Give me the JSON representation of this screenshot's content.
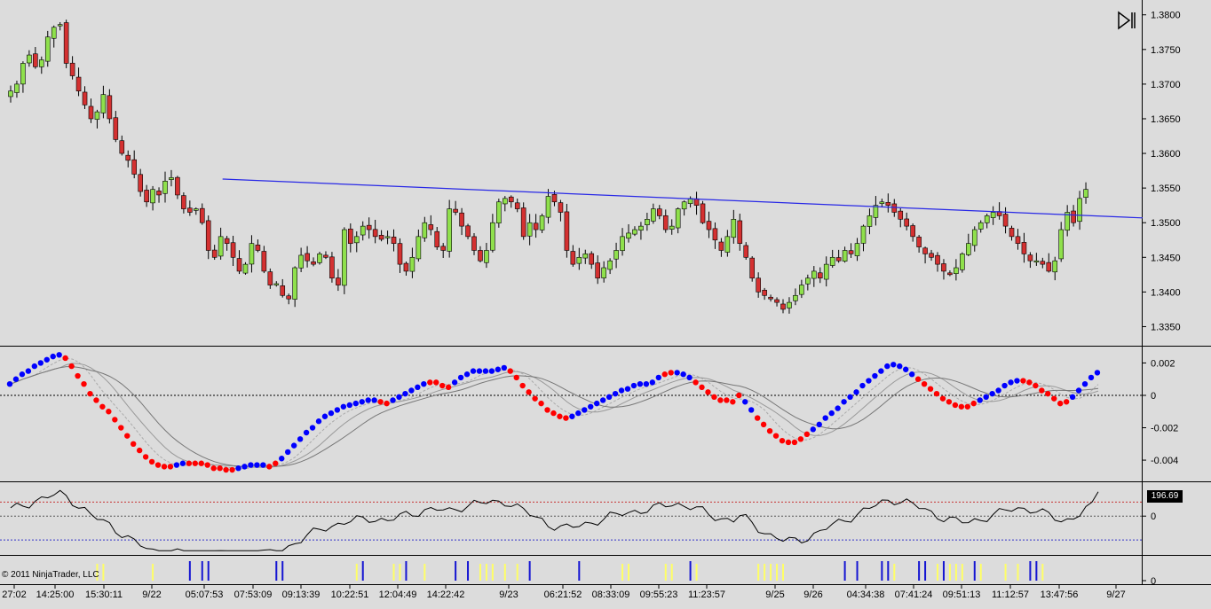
{
  "copyright": "© 2011 NinjaTrader, LLC",
  "colors": {
    "background": "#dcdcdc",
    "up_candle": "#8fe04c",
    "down_candle": "#d43131",
    "trendline": "#2828e6",
    "dot_up": "#0000ff",
    "dot_down": "#ff0000",
    "bar_blue": "#1414d2",
    "bar_yellow": "#ffff66"
  },
  "chart_data": [
    {
      "type": "candlestick",
      "panel": "price",
      "y_ticks": [
        "1.3800",
        "1.3750",
        "1.3700",
        "1.3650",
        "1.3600",
        "1.3550",
        "1.3500",
        "1.3450",
        "1.3400",
        "1.3350"
      ],
      "ylim": [
        1.3325,
        1.3815
      ],
      "x_labels": [
        "27:02",
        "14:25:00",
        "15:30:11",
        "9/22",
        "05:07:53",
        "07:53:09",
        "09:13:39",
        "10:22:51",
        "12:04:49",
        "14:22:42",
        "9/23",
        "06:21:52",
        "08:33:09",
        "09:55:23",
        "11:23:57",
        "9/25",
        "9/26",
        "04:34:38",
        "07:41:24",
        "09:51:13",
        "11:12:57",
        "13:47:56",
        "9/27"
      ],
      "series": [
        {
          "name": "close",
          "values": [
            1.369,
            1.37,
            1.373,
            1.3742,
            1.3725,
            1.3735,
            1.3768,
            1.3782,
            1.3786,
            1.373,
            1.3712,
            1.369,
            1.367,
            1.365,
            1.366,
            1.3685,
            1.365,
            1.362,
            1.36,
            1.359,
            1.357,
            1.3545,
            1.353,
            1.3548,
            1.354,
            1.356,
            1.3565,
            1.354,
            1.352,
            1.3515,
            1.352,
            1.35,
            1.346,
            1.345,
            1.348,
            1.347,
            1.345,
            1.343,
            1.344,
            1.347,
            1.346,
            1.343,
            1.341,
            1.3412,
            1.3395,
            1.339,
            1.3435,
            1.3453,
            1.3445,
            1.344,
            1.3455,
            1.345,
            1.342,
            1.341,
            1.349,
            1.347,
            1.348,
            1.3495,
            1.349,
            1.348,
            1.3476,
            1.348,
            1.347,
            1.344,
            1.343,
            1.345,
            1.348,
            1.35,
            1.349,
            1.3465,
            1.346,
            1.352,
            1.3515,
            1.3495,
            1.348,
            1.346,
            1.3445,
            1.346,
            1.35,
            1.353,
            1.3535,
            1.353,
            1.352,
            1.348,
            1.35,
            1.349,
            1.351,
            1.3538,
            1.353,
            1.3515,
            1.346,
            1.344,
            1.345,
            1.3455,
            1.344,
            1.342,
            1.3435,
            1.3445,
            1.346,
            1.348,
            1.3485,
            1.349,
            1.3495,
            1.3505,
            1.352,
            1.351,
            1.349,
            1.3495,
            1.352,
            1.353,
            1.3535,
            1.3525,
            1.35,
            1.349,
            1.3475,
            1.346,
            1.348,
            1.3505,
            1.347,
            1.345,
            1.342,
            1.34,
            1.3395,
            1.339,
            1.3385,
            1.3375,
            1.3385,
            1.3395,
            1.341,
            1.342,
            1.343,
            1.342,
            1.344,
            1.345,
            1.3445,
            1.346,
            1.3455,
            1.347,
            1.3495,
            1.351,
            1.3525,
            1.353,
            1.3525,
            1.3515,
            1.3505,
            1.3495,
            1.348,
            1.3465,
            1.3455,
            1.345,
            1.344,
            1.343,
            1.3425,
            1.3435,
            1.3455,
            1.347,
            1.349,
            1.35,
            1.351,
            1.3515,
            1.351,
            1.3495,
            1.348,
            1.347,
            1.3455,
            1.3445,
            1.3445,
            1.344,
            1.343,
            1.3445,
            1.349,
            1.3515,
            1.35,
            1.3535,
            1.3548
          ]
        }
      ],
      "trendline": {
        "from": [
          33,
          1.3563
        ],
        "to": [
          166,
          1.3512
        ]
      }
    },
    {
      "type": "line",
      "panel": "oscillator",
      "y_ticks": [
        "0.002",
        "0",
        "-0.002",
        "-0.004"
      ],
      "ylim": [
        -0.0052,
        0.0029
      ],
      "series": [
        {
          "name": "dots",
          "values": [
            0.0007,
            0.001,
            0.0013,
            0.0015,
            0.0018,
            0.002,
            0.0022,
            0.0024,
            0.0025,
            0.0023,
            0.0018,
            0.0012,
            0.0007,
            0.0001,
            -0.0003,
            -0.0007,
            -0.001,
            -0.0015,
            -0.002,
            -0.0025,
            -0.003,
            -0.0034,
            -0.0038,
            -0.0041,
            -0.0043,
            -0.0044,
            -0.0044,
            -0.0043,
            -0.0042,
            -0.0042,
            -0.0042,
            -0.0042,
            -0.0043,
            -0.0045,
            -0.0045,
            -0.0046,
            -0.0046,
            -0.0045,
            -0.0044,
            -0.0043,
            -0.0043,
            -0.0043,
            -0.0044,
            -0.0042,
            -0.0039,
            -0.0035,
            -0.0031,
            -0.0027,
            -0.0023,
            -0.002,
            -0.0016,
            -0.0013,
            -0.0011,
            -0.0009,
            -0.0007,
            -0.0006,
            -0.0005,
            -0.0004,
            -0.0003,
            -0.0003,
            -0.0004,
            -0.0005,
            -0.0003,
            -0.0001,
            0.0001,
            0.0003,
            0.0005,
            0.0007,
            0.0008,
            0.0008,
            0.0006,
            0.0005,
            0.0008,
            0.0011,
            0.0013,
            0.0015,
            0.0015,
            0.0015,
            0.0015,
            0.0016,
            0.0017,
            0.0015,
            0.0011,
            0.0006,
            0.0002,
            -0.0002,
            -0.0005,
            -0.0009,
            -0.0011,
            -0.0013,
            -0.0014,
            -0.0013,
            -0.0011,
            -0.0009,
            -0.0007,
            -0.0005,
            -0.0003,
            -0.0001,
            0.0001,
            0.0003,
            0.0004,
            0.0006,
            0.0007,
            0.0007,
            0.0008,
            0.0011,
            0.0013,
            0.0014,
            0.0014,
            0.0013,
            0.0011,
            0.0008,
            0.0005,
            0.0002,
            -0.0001,
            -0.0003,
            -0.0003,
            -0.0004,
            0.0,
            -0.0004,
            -0.0009,
            -0.0014,
            -0.0018,
            -0.0022,
            -0.0025,
            -0.0028,
            -0.0029,
            -0.0029,
            -0.0027,
            -0.0024,
            -0.0021,
            -0.0018,
            -0.0014,
            -0.0011,
            -0.0008,
            -0.0004,
            -0.0001,
            0.0002,
            0.0006,
            0.0009,
            0.0012,
            0.0015,
            0.0018,
            0.0019,
            0.0018,
            0.0016,
            0.0013,
            0.001,
            0.0007,
            0.0004,
            0.0001,
            -0.0002,
            -0.0004,
            -0.0006,
            -0.0007,
            -0.0007,
            -0.0005,
            -0.0003,
            -0.0001,
            0.0001,
            0.0003,
            0.0006,
            0.0008,
            0.0009,
            0.0009,
            0.0008,
            0.0006,
            0.0003,
            0.0001,
            -0.0002,
            -0.0005,
            -0.0004,
            -0.0001,
            0.0003,
            0.0007,
            0.0011,
            0.0014
          ],
          "colors": [
            "up",
            "up",
            "up",
            "up",
            "up",
            "up",
            "up",
            "up",
            "up",
            "down",
            "down",
            "down",
            "down",
            "down",
            "down",
            "down",
            "down",
            "down",
            "down",
            "down",
            "down",
            "down",
            "down",
            "down",
            "down",
            "down",
            "down",
            "up",
            "up",
            "down",
            "down",
            "down",
            "down",
            "down",
            "down",
            "down",
            "down",
            "up",
            "up",
            "up",
            "up",
            "up",
            "down",
            "down",
            "up",
            "up",
            "up",
            "up",
            "up",
            "up",
            "up",
            "up",
            "up",
            "up",
            "up",
            "up",
            "up",
            "up",
            "up",
            "up",
            "down",
            "down",
            "up",
            "up",
            "up",
            "up",
            "up",
            "up",
            "down",
            "down",
            "down",
            "down",
            "up",
            "up",
            "up",
            "up",
            "up",
            "up",
            "up",
            "up",
            "up",
            "down",
            "down",
            "down",
            "down",
            "down",
            "down",
            "down",
            "down",
            "down",
            "down",
            "up",
            "up",
            "up",
            "up",
            "up",
            "up",
            "up",
            "up",
            "up",
            "up",
            "up",
            "up",
            "up",
            "up",
            "up",
            "down",
            "down",
            "up",
            "up",
            "up",
            "down",
            "down",
            "down",
            "down",
            "down",
            "down",
            "down",
            "down",
            "up",
            "up",
            "down",
            "down",
            "down",
            "down",
            "down",
            "down",
            "down",
            "down",
            "down",
            "up",
            "up",
            "up",
            "up",
            "up",
            "up",
            "up",
            "up",
            "up",
            "up",
            "up",
            "up",
            "up",
            "up",
            "up",
            "up",
            "up",
            "down",
            "down",
            "down",
            "down",
            "down",
            "down",
            "down",
            "down",
            "down",
            "down",
            "up",
            "up",
            "up",
            "up",
            "up",
            "up",
            "up",
            "down",
            "down",
            "down",
            "down",
            "down",
            "down",
            "down",
            "down",
            "up",
            "up",
            "up",
            "up",
            "up"
          ]
        }
      ]
    },
    {
      "type": "line",
      "panel": "cci",
      "y_ticks": [
        "0"
      ],
      "current_value_label": "196.69",
      "ylim": [
        -300,
        260
      ]
    },
    {
      "type": "bar",
      "panel": "markers",
      "y_ticks": [
        "0"
      ]
    }
  ]
}
